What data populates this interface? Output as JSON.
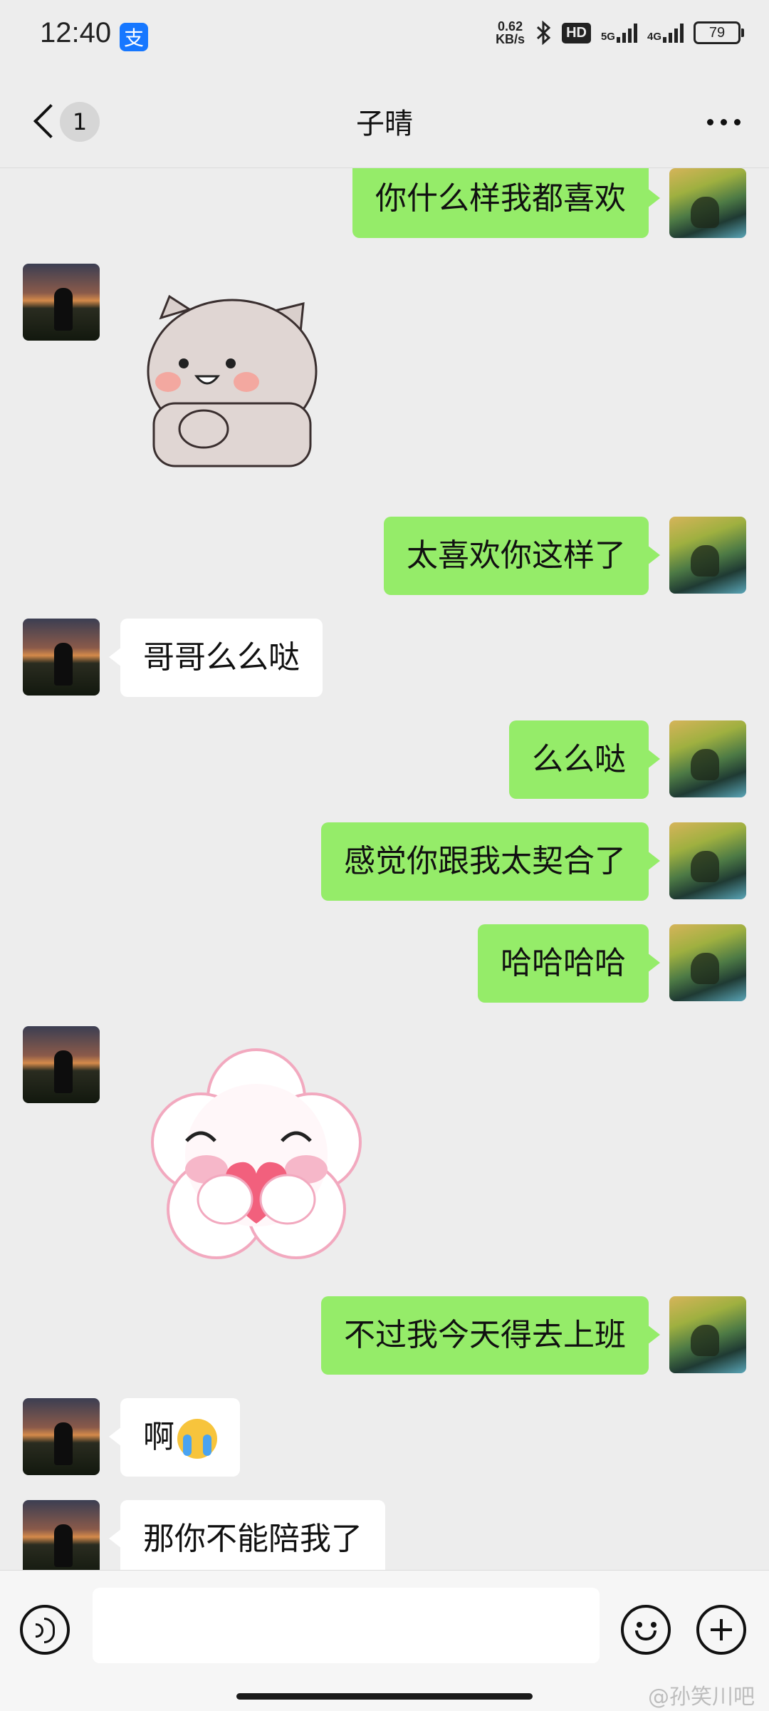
{
  "status_bar": {
    "time": "12:40",
    "app_badge": "支",
    "net_speed_value": "0.62",
    "net_speed_unit": "KB/s",
    "hd_label": "HD",
    "sig1_label": "5G",
    "sig2_label": "4G",
    "battery": "79"
  },
  "nav": {
    "unread_count": "1",
    "title": "子晴"
  },
  "messages": [
    {
      "side": "out",
      "text": "你什么样我都喜欢"
    },
    {
      "side": "in",
      "type": "sticker",
      "name": "cat-sticker"
    },
    {
      "side": "out",
      "text": "太喜欢你这样了"
    },
    {
      "side": "in",
      "text": "哥哥么么哒"
    },
    {
      "side": "out",
      "text": "么么哒"
    },
    {
      "side": "out",
      "text": "感觉你跟我太契合了"
    },
    {
      "side": "out",
      "text": "哈哈哈哈"
    },
    {
      "side": "in",
      "type": "sticker",
      "name": "flower-heart-sticker"
    },
    {
      "side": "out",
      "text": "不过我今天得去上班"
    },
    {
      "side": "in",
      "text": "啊",
      "emoji": "crying-face"
    },
    {
      "side": "in",
      "text": "那你不能陪我了"
    }
  ],
  "input": {
    "value": ""
  },
  "watermark": "@孙笑川吧",
  "colors": {
    "outgoing_bubble": "#95ec69",
    "incoming_bubble": "#ffffff",
    "background": "#ededed"
  }
}
